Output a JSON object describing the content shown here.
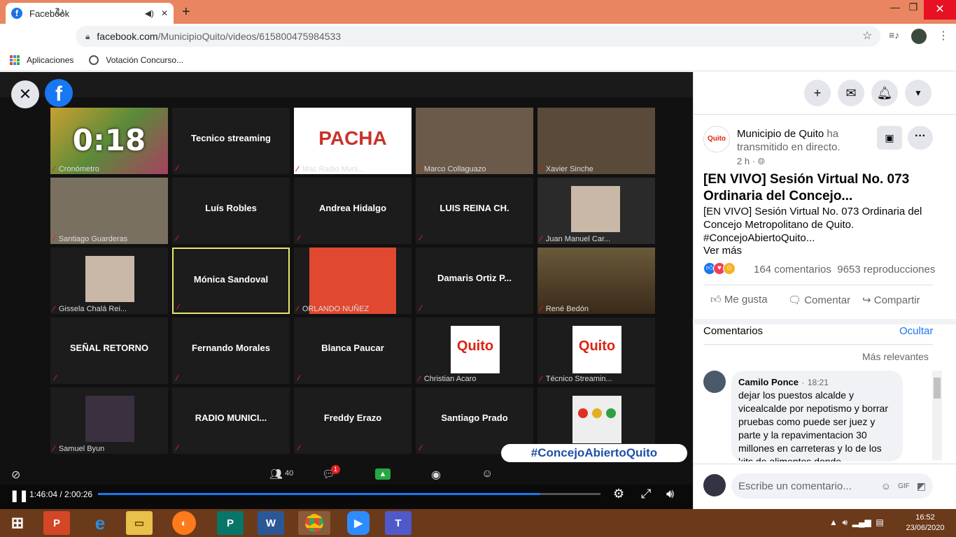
{
  "browser": {
    "tab_title": "Facebook",
    "url_host": "facebook.com",
    "url_path": "/MunicipioQuito/videos/615800475984533",
    "bookmarks": [
      "Aplicaciones",
      "Votación Concurso..."
    ]
  },
  "video": {
    "tiles": [
      {
        "label": "Cronómetro",
        "timer": "0:18"
      },
      {
        "name": "Tecnico streaming"
      },
      {
        "label": "Mac Radio Muni...",
        "logo": "PACHA"
      },
      {
        "label": "Marco Collaguazo"
      },
      {
        "label": "Xavier Sinche"
      },
      {
        "label": "Santiago Guarderas"
      },
      {
        "name": "Luís Robles"
      },
      {
        "name": "Andrea Hidalgo"
      },
      {
        "name": "LUIS REINA CH."
      },
      {
        "label": "Juan Manuel Car..."
      },
      {
        "label": "Gissela Chalá Rei..."
      },
      {
        "name": "Mónica Sandoval"
      },
      {
        "label": "ORLANDO NUÑEZ"
      },
      {
        "name": "Damaris  Ortiz  P..."
      },
      {
        "label": "René Bedón"
      },
      {
        "name": "SEÑAL RETORNO"
      },
      {
        "name": "Fernando Morales"
      },
      {
        "name": "Blanca Paucar"
      },
      {
        "label": "Christian Acaro",
        "logo": "Quito"
      },
      {
        "label": "Técnico Streamin...",
        "logo": "Quito"
      },
      {
        "label": "Samuel Byun"
      },
      {
        "name": "RADIO  MUNICI..."
      },
      {
        "name": "Freddy Erazo"
      },
      {
        "name": "Santiago Prado"
      },
      {
        "label": ""
      }
    ],
    "hashtag": "#ConcejoAbiertoQuito",
    "participants_count": "40",
    "chat_badge": "1",
    "current_time": "1:46:04",
    "duration": "2:00:26",
    "time_display": "1:46:04 / 2:00:26",
    "progress": 0.88
  },
  "post": {
    "page_name": "Municipio de Quito",
    "action": "ha transmitido en directo.",
    "time": "2 h",
    "title": "[EN VIVO] Sesión Virtual No. 073 Ordinaria del Concejo...",
    "description": "[EN VIVO] Sesión Virtual No. 073 Ordinaria del Concejo Metropolitano de Quito. #ConcejoAbiertoQuito...",
    "see_more": "Ver más",
    "comments_count": "164 comentarios",
    "views": "9653 reproducciones",
    "like": "Me gusta",
    "comment": "Comentar",
    "share": "Compartir"
  },
  "comments": {
    "header": "Comentarios",
    "hide": "Ocultar",
    "sort": "Más relevantes",
    "items": [
      {
        "author": "Camilo Ponce",
        "time": "18:21",
        "text": "dejar los puestos alcalde y vicealcalde por nepotismo y borrar pruebas como puede ser juez y parte y la repavimentacion 30 millones en carreteras y lo de los kits de alimentos donde"
      }
    ],
    "input_placeholder": "Escribe un comentario..."
  },
  "taskbar": {
    "time": "16:52",
    "date": "23/06/2020"
  },
  "colors": {
    "tab_bar": "#e98560",
    "facebook_blue": "#1877f2",
    "taskbar": "#6b3a1a",
    "active_speaker_border": "#e8e86a"
  }
}
